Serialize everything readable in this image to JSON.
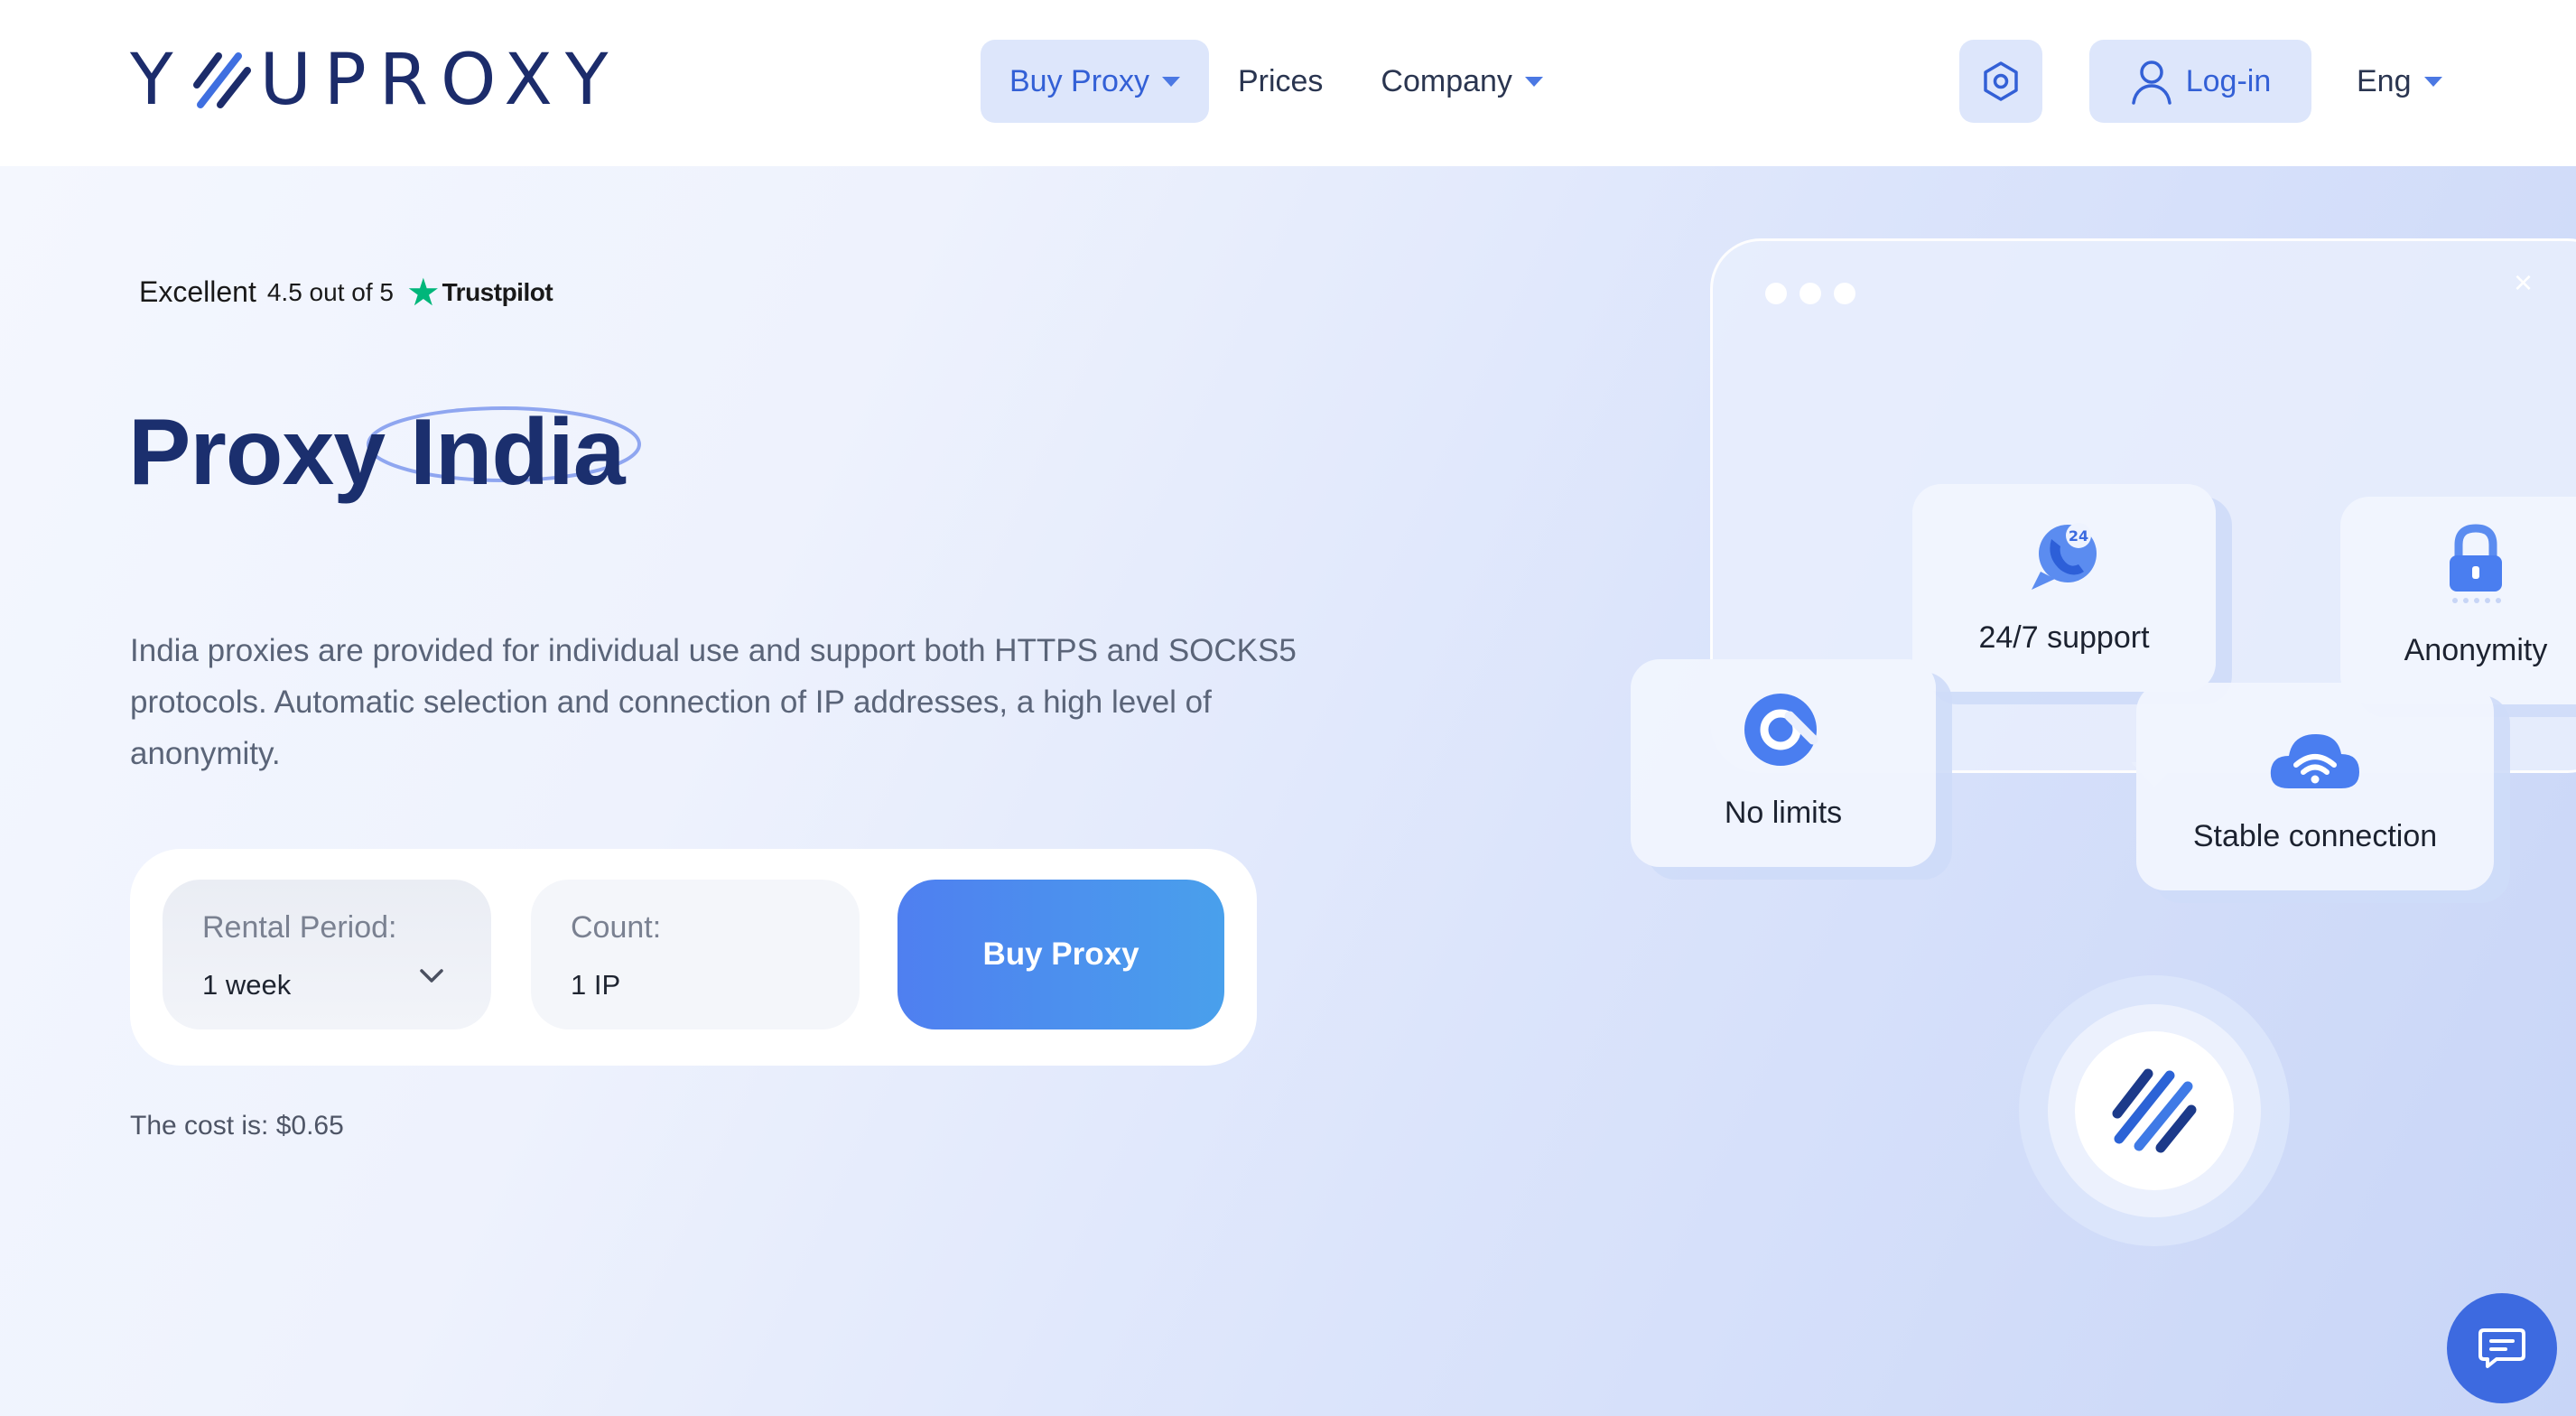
{
  "header": {
    "logo_text_left": "Y",
    "logo_text_right": "UPROXY",
    "nav": [
      {
        "label": "Buy Proxy",
        "has_caret": true,
        "active": true
      },
      {
        "label": "Prices",
        "has_caret": false,
        "active": false
      },
      {
        "label": "Company",
        "has_caret": true,
        "active": false
      }
    ],
    "settings_icon": "hexagon-settings-icon",
    "login_label": "Log-in",
    "language": "Eng"
  },
  "trustpilot": {
    "rating_word": "Excellent",
    "score_text": "4.5 out of 5",
    "brand": "Trustpilot"
  },
  "hero": {
    "title_part1": "Proxy",
    "title_part2": "India",
    "description": "India proxies are provided for individual use and support both HTTPS and SOCKS5 protocols. Automatic selection and connection of IP addresses, a high level of anonymity."
  },
  "order_form": {
    "rental_label": "Rental Period:",
    "rental_value": "1 week",
    "count_label": "Count:",
    "count_value": "1 IP",
    "buy_label": "Buy Proxy",
    "cost_text": "The cost is: $0.65"
  },
  "features": {
    "support": "24/7 support",
    "support_badge": "24",
    "anonymity": "Anonymity",
    "no_limits": "No limits",
    "stable": "Stable connection"
  },
  "colors": {
    "brand_dark": "#1c2c6b",
    "accent": "#3360d6",
    "trustpilot_green": "#00b67a"
  }
}
